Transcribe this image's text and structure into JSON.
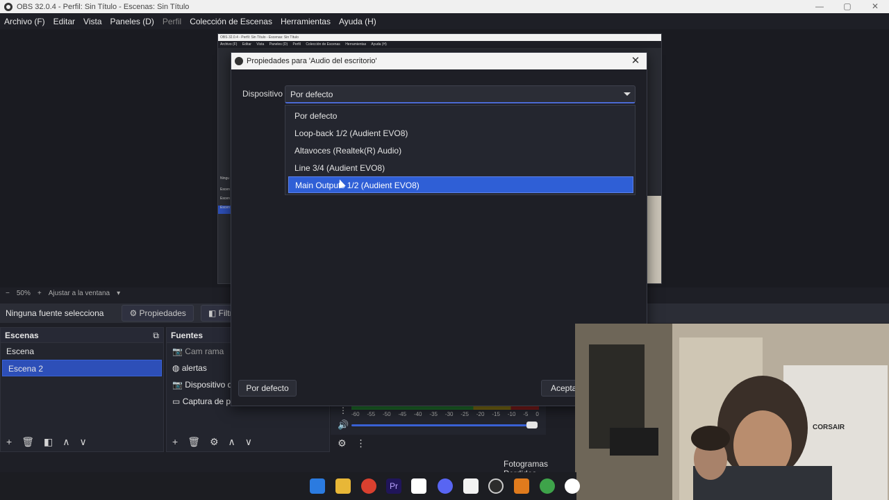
{
  "window": {
    "title": "OBS 32.0.4 - Perfil: Sin Título - Escenas: Sin Título"
  },
  "menubar": {
    "items": [
      "Archivo (F)",
      "Editar",
      "Vista",
      "Paneles (D)",
      "Perfil",
      "Colección de Escenas",
      "Herramientas",
      "Ayuda (H)"
    ]
  },
  "nested": {
    "title": "OBS 32.0.4 - Perfil: Sin Título - Escenas: Sin Título",
    "menu": [
      "Archivo (F)",
      "Editar",
      "Vista",
      "Paneles (D)",
      "Perfil",
      "Colección de Escenas",
      "Herramientas",
      "Ayuda (H)"
    ],
    "side": [
      "Ningu",
      "Escen",
      "Escen",
      "Escen"
    ]
  },
  "zoom": {
    "minus": "−",
    "value": "50%",
    "plus": "+",
    "fit": "Ajustar a la ventana"
  },
  "source_toolbar": {
    "no_source": "Ninguna fuente selecciona",
    "properties": "Propiedades",
    "filters": "Filtro"
  },
  "scenes": {
    "title": "Escenas",
    "items": [
      "Escena",
      "Escena 2"
    ]
  },
  "sources": {
    "title": "Fuentes",
    "items": [
      "Cam rama",
      "alertas",
      "Dispositivo d",
      "Captura de pantalla"
    ]
  },
  "mixer": {
    "scale": [
      "-60",
      "-55",
      "-50",
      "-45",
      "-40",
      "-35",
      "-30",
      "-25",
      "-20",
      "-15",
      "-10",
      "-5",
      "0"
    ]
  },
  "status": {
    "dropped_frames": "Fotogramas Perdidos"
  },
  "dialog": {
    "title": "Propiedades para 'Audio del escritorio'",
    "close": "✕",
    "device_label": "Dispositivo",
    "device_value": "Por defecto",
    "options": [
      "Por defecto",
      "Loop-back 1/2 (Audient EVO8)",
      "Altavoces (Realtek(R) Audio)",
      "Line 3/4 (Audient EVO8)",
      "Main Outputs 1/2 (Audient EVO8)"
    ],
    "selected_index": 4,
    "defaults_button": "Por defecto",
    "accept_button": "Aceptar"
  },
  "webcam": {
    "brand": "CORSAIR"
  },
  "colors": {
    "accent": "#2f5fd6",
    "bg": "#1e1f26",
    "panel": "#23252e"
  }
}
